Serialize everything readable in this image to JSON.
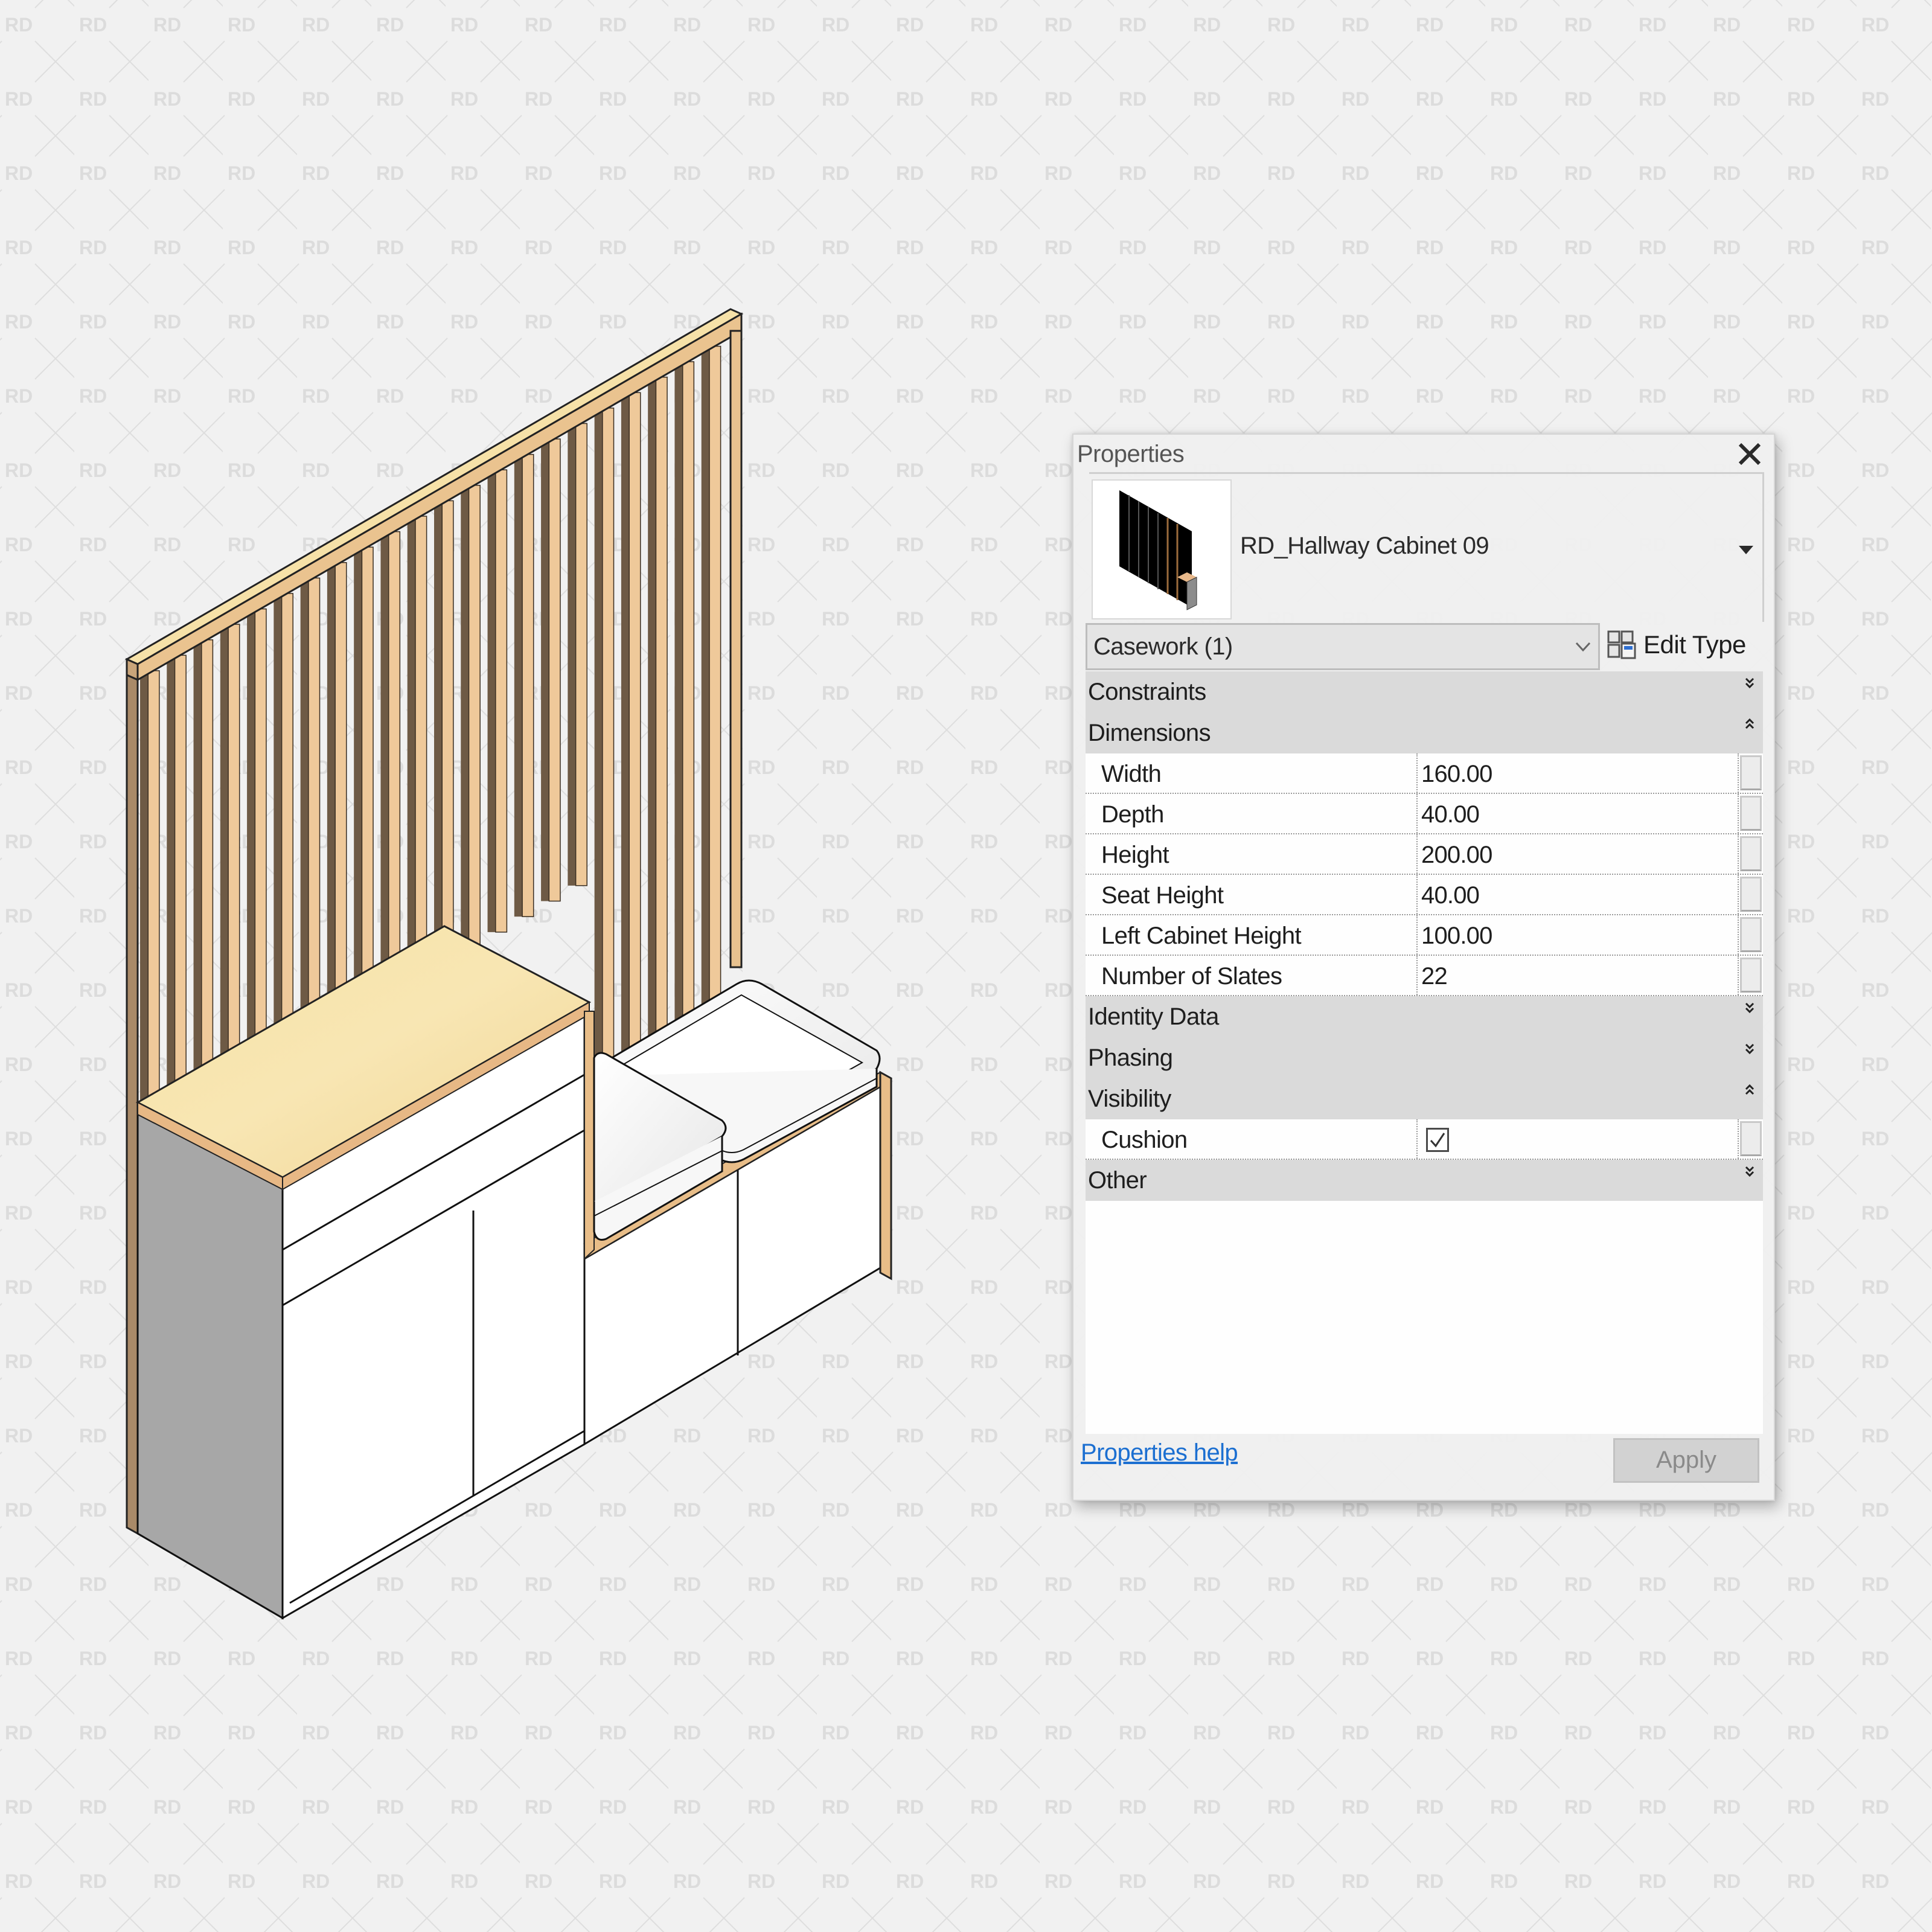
{
  "background": {
    "watermark_text": "RD",
    "color": "#f1f1f1"
  },
  "model": {
    "description": "Isometric 3D view of hallway cabinet with wood slat wall panel, left tall cabinet with wood top, bench with two cushions",
    "colors": {
      "wood_light": "#efc99a",
      "wood_dark": "#6e5a45",
      "wood_top": "#f3dd9e",
      "cabinet_white": "#ffffff",
      "cabinet_side": "#a5a5a5",
      "outline": "#111111"
    }
  },
  "properties_panel": {
    "title": "Properties",
    "close_icon": "close-icon",
    "type_selector": {
      "name": "RD_Hallway Cabinet 09",
      "dropdown_icon": "triangle-down-icon"
    },
    "category_filter": {
      "value": "Casework (1)",
      "chevron_icon": "chevron-down-icon"
    },
    "edit_type": {
      "label": "Edit Type",
      "icon": "edit-type-icon"
    },
    "groups": [
      {
        "name": "Constraints",
        "expanded": false,
        "rows": []
      },
      {
        "name": "Dimensions",
        "expanded": true,
        "rows": [
          {
            "label": "Width",
            "value": "160.00"
          },
          {
            "label": "Depth",
            "value": "40.00"
          },
          {
            "label": "Height",
            "value": "200.00"
          },
          {
            "label": "Seat Height",
            "value": "40.00"
          },
          {
            "label": "Left Cabinet Height",
            "value": "100.00"
          },
          {
            "label": "Number of Slates",
            "value": "22"
          }
        ]
      },
      {
        "name": "Identity Data",
        "expanded": false,
        "rows": []
      },
      {
        "name": "Phasing",
        "expanded": false,
        "rows": []
      },
      {
        "name": "Visibility",
        "expanded": true,
        "rows": [
          {
            "label": "Cushion",
            "checked": true
          }
        ]
      },
      {
        "name": "Other",
        "expanded": false,
        "rows": []
      }
    ],
    "footer": {
      "help_link": "Properties help",
      "apply_label": "Apply",
      "apply_enabled": false
    },
    "colors": {
      "link": "#1c6fd1",
      "group_header_bg": "#d8d8d8",
      "apply_disabled_bg": "#d2d2d2"
    }
  }
}
